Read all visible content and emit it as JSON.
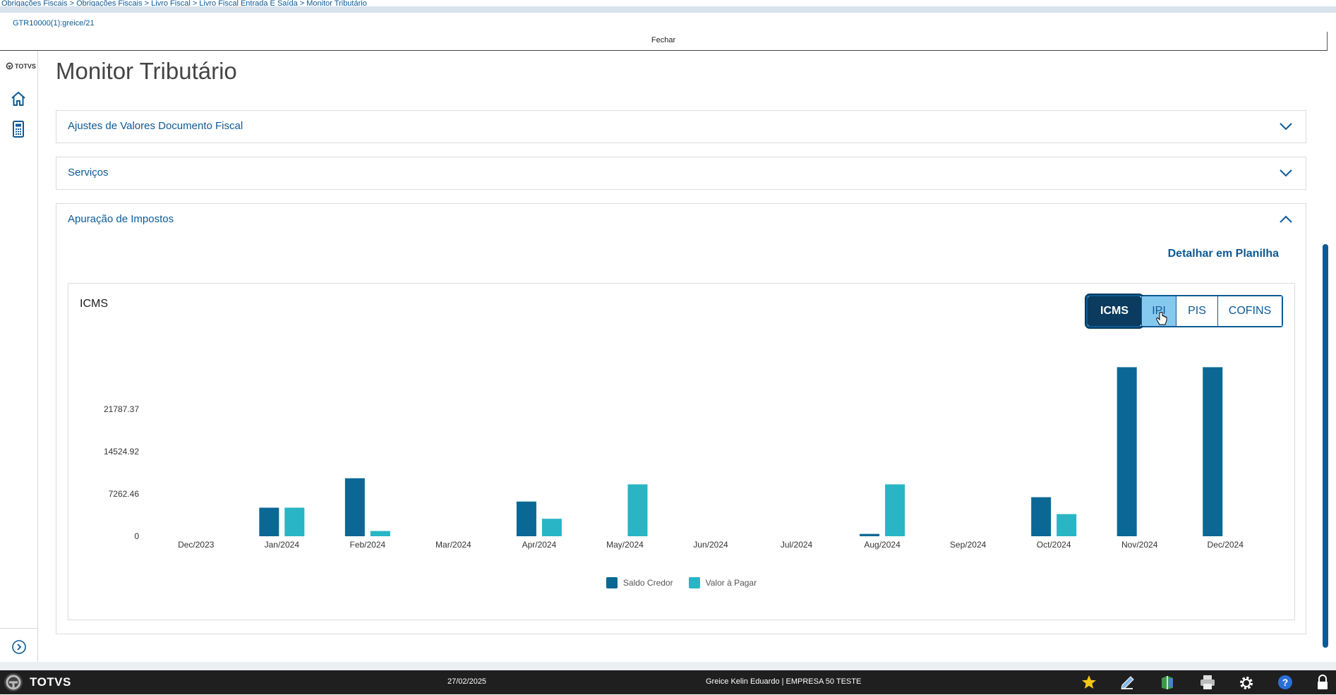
{
  "breadcrumb": "Obrigações Fiscais > Obrigações Fiscais > Livro Fiscal > Livro Fiscal Entrada E Saída > Monitor Tributário",
  "routine": "GTR10000(1):greice/21",
  "close_label": "Fechar",
  "sidebar": {
    "logo": "TOTVS",
    "items": [
      {
        "icon": "home-icon"
      },
      {
        "icon": "calculator-icon"
      }
    ],
    "expand_icon": "chevron-right-circle-icon"
  },
  "page_title": "Monitor Tributário",
  "accordions": [
    {
      "title": "Ajustes de Valores Documento Fiscal",
      "expanded": false
    },
    {
      "title": "Serviços",
      "expanded": false
    },
    {
      "title": "Apuração de Impostos",
      "expanded": true
    }
  ],
  "detail_link": "Detalhar em Planilha",
  "tax_tabs": [
    {
      "label": "ICMS",
      "state": "selected"
    },
    {
      "label": "IPI",
      "state": "hover"
    },
    {
      "label": "PIS",
      "state": "normal"
    },
    {
      "label": "COFINS",
      "state": "normal"
    }
  ],
  "chart_data": {
    "type": "bar",
    "title": "ICMS",
    "categories": [
      "Dec/2023",
      "Jan/2024",
      "Feb/2024",
      "Mar/2024",
      "Apr/2024",
      "May/2024",
      "Jun/2024",
      "Jul/2024",
      "Aug/2024",
      "Sep/2024",
      "Oct/2024",
      "Nov/2024",
      "Dec/2024"
    ],
    "y_ticks": [
      "0",
      "7262.46",
      "14524.92",
      "21787.37"
    ],
    "ylim": [
      0,
      29049.83
    ],
    "series": [
      {
        "name": "Saldo Credor",
        "color": "#0b6894",
        "values": [
          0,
          4900,
          9950,
          0,
          5950,
          0,
          0,
          0,
          400,
          0,
          6700,
          29000,
          29000
        ]
      },
      {
        "name": "Valor à Pagar",
        "color": "#29b5c4",
        "values": [
          0,
          4900,
          900,
          0,
          3000,
          8900,
          0,
          0,
          8900,
          0,
          3800,
          0,
          0
        ]
      }
    ],
    "legend_position": "bottom",
    "grid": false
  },
  "status": {
    "brand": "TOTVS",
    "date": "27/02/2025",
    "user": "Greice Kelin Eduardo | EMPRESA 50 TESTE",
    "icons": [
      "star-icon",
      "pen-icon",
      "book-icon",
      "printer-icon",
      "gear-icon",
      "help-icon",
      "lock-icon"
    ]
  }
}
